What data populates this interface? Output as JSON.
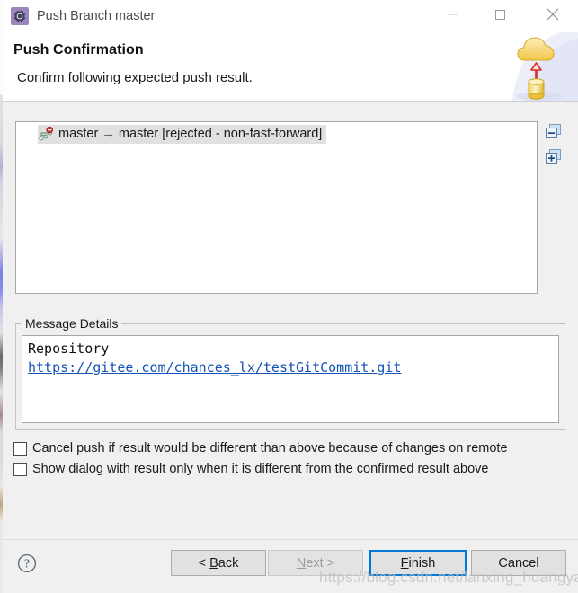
{
  "window": {
    "title": "Push Branch master",
    "icon": "gear-icon",
    "controls": {
      "minimize": "minimize-icon",
      "maximize": "maximize-icon",
      "close": "close-icon"
    }
  },
  "header": {
    "title": "Push Confirmation",
    "subtitle": "Confirm following expected push result.",
    "artwork": "cloud-upload-database-icon"
  },
  "result_list": {
    "rows": [
      {
        "icon": "branch-rejected-icon",
        "label": "master → master [rejected - non-fast-forward]",
        "selected": true
      }
    ]
  },
  "side_tools": [
    {
      "name": "collapse-all-button",
      "icon": "collapse-all-icon",
      "tooltip": "Collapse All"
    },
    {
      "name": "expand-all-button",
      "icon": "expand-all-icon",
      "tooltip": "Expand All"
    }
  ],
  "message_details": {
    "group_title": "Message Details",
    "heading": "Repository",
    "link": "https://gitee.com/chances_lx/testGitCommit.git"
  },
  "options": [
    {
      "label": "Cancel push if result would be different than above because of changes on remote",
      "checked": false
    },
    {
      "label": "Show dialog with result only when it is different from the confirmed result above",
      "checked": false
    }
  ],
  "footer": {
    "help": "help-icon",
    "buttons": [
      {
        "name": "back-button",
        "label": "< Back",
        "mnemonic": "B",
        "enabled": true,
        "focused": false
      },
      {
        "name": "next-button",
        "label": "Next >",
        "mnemonic": "N",
        "enabled": false,
        "focused": false
      },
      {
        "name": "finish-button",
        "label": "Finish",
        "mnemonic": "F",
        "enabled": true,
        "focused": true
      },
      {
        "name": "cancel-button",
        "label": "Cancel",
        "mnemonic": "",
        "enabled": true,
        "focused": false
      }
    ]
  },
  "watermark": "https://blog.csdn.net/lanxing_huangyao",
  "colors": {
    "accent": "#0078d7",
    "link": "#1553b6",
    "dialog_bg": "#f0f0f0",
    "header_bg": "#ffffff",
    "selection_bg": "#e0e0e0",
    "error_badge": "#d0342c"
  }
}
